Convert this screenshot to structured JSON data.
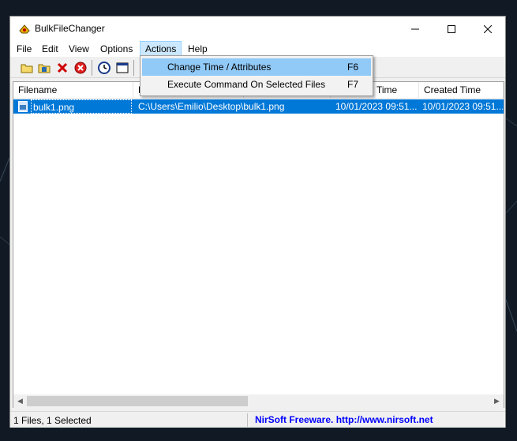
{
  "window": {
    "title": "BulkFileChanger"
  },
  "menu": {
    "items": [
      {
        "label": "File"
      },
      {
        "label": "Edit"
      },
      {
        "label": "View"
      },
      {
        "label": "Options"
      },
      {
        "label": "Actions"
      },
      {
        "label": "Help"
      }
    ],
    "active": "Actions"
  },
  "actions_menu": {
    "items": [
      {
        "label": "Change Time / Attributes",
        "shortcut": "F6"
      },
      {
        "label": "Execute Command On Selected Files",
        "shortcut": "F7"
      }
    ]
  },
  "table": {
    "columns": [
      "Filename",
      "F",
      "Time",
      "Created Time"
    ],
    "rows": [
      {
        "filename": "bulk1.png",
        "path": "C:\\Users\\Emilio\\Desktop\\bulk1.png",
        "modified": "10/01/2023 09:51...",
        "created": "10/01/2023 09:51..."
      }
    ]
  },
  "status": {
    "left": "1 Files, 1 Selected",
    "right": "NirSoft Freeware.  http://www.nirsoft.net"
  },
  "colors": {
    "selection": "#0078d7",
    "menu_highlight": "#91c9f7",
    "link": "#0000ff"
  }
}
